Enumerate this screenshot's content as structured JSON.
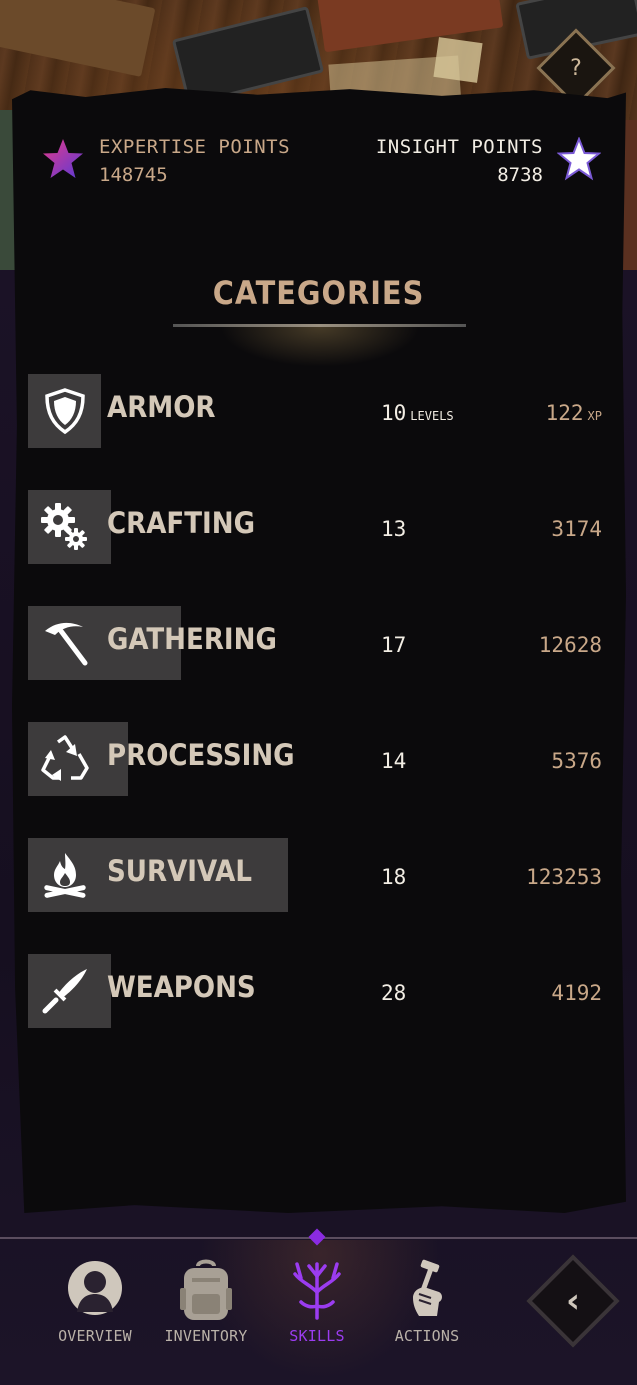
{
  "header": {
    "help_label": "?",
    "expertise": {
      "label": "EXPERTISE POINTS",
      "value": "148745"
    },
    "insight": {
      "label": "INSIGHT POINTS",
      "value": "8738"
    }
  },
  "categories": {
    "title": "CATEGORIES",
    "level_unit": "LEVELS",
    "xp_unit": "XP",
    "items": [
      {
        "name": "ARMOR",
        "icon": "shield-icon",
        "levels": "10",
        "xp": "122",
        "bar_fraction": 0.12
      },
      {
        "name": "CRAFTING",
        "icon": "gears-icon",
        "levels": "13",
        "xp": "3174",
        "bar_fraction": 0.14
      },
      {
        "name": "GATHERING",
        "icon": "pickaxe-icon",
        "levels": "17",
        "xp": "12628",
        "bar_fraction": 0.26
      },
      {
        "name": "PROCESSING",
        "icon": "recycle-icon",
        "levels": "14",
        "xp": "5376",
        "bar_fraction": 0.17
      },
      {
        "name": "SURVIVAL",
        "icon": "campfire-icon",
        "levels": "18",
        "xp": "123253",
        "bar_fraction": 0.44
      },
      {
        "name": "WEAPONS",
        "icon": "knife-icon",
        "levels": "28",
        "xp": "4192",
        "bar_fraction": 0.14
      }
    ]
  },
  "nav": {
    "items": [
      {
        "label": "OVERVIEW",
        "icon": "person-icon"
      },
      {
        "label": "INVENTORY",
        "icon": "backpack-icon"
      },
      {
        "label": "SKILLS",
        "icon": "skill-tree-icon",
        "active": true
      },
      {
        "label": "ACTIONS",
        "icon": "hand-hammer-icon"
      }
    ],
    "back_label": "‹"
  },
  "colors": {
    "accent_purple": "#9b3cf0",
    "gold_text": "#c9a889",
    "panel": "#0b0a0c"
  }
}
